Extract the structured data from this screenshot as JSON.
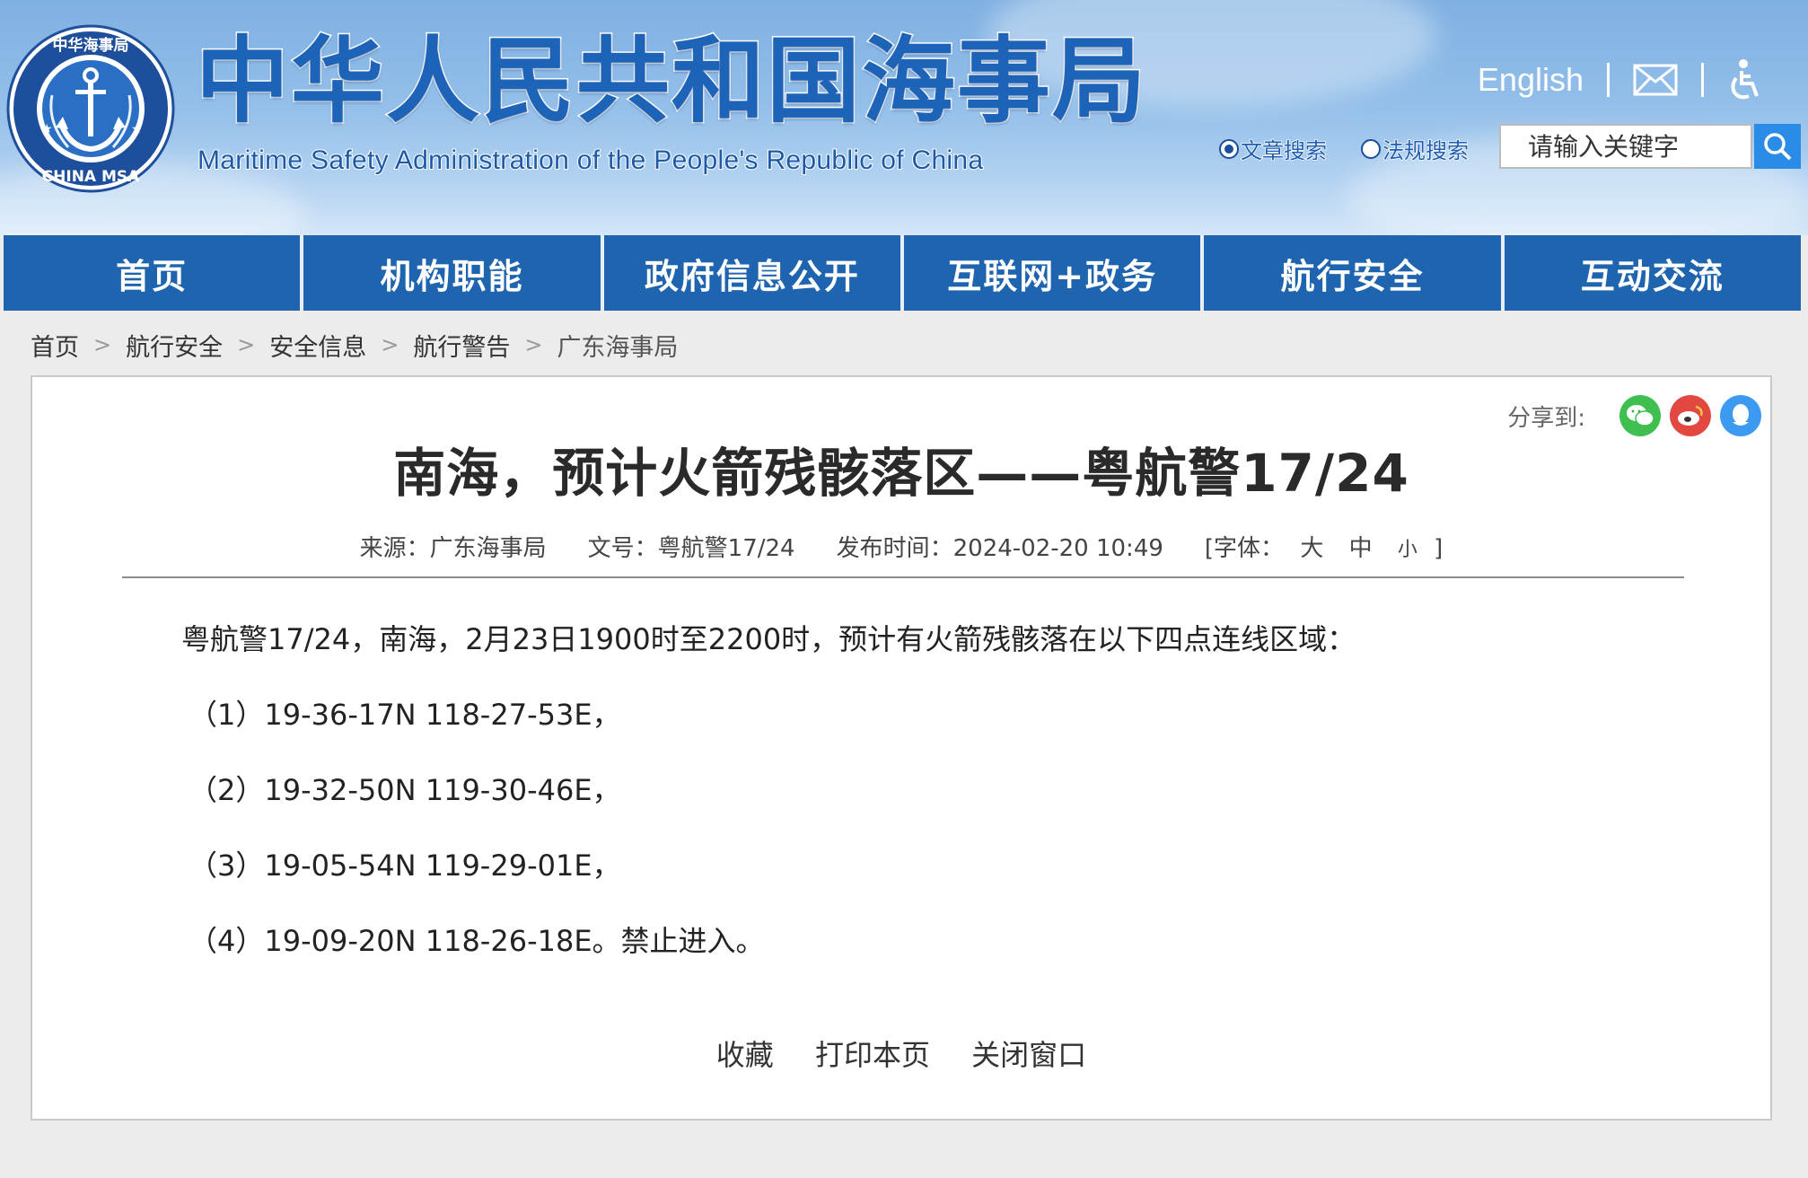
{
  "header": {
    "title": "中华人民共和国海事局",
    "subtitle": "Maritime Safety Administration of the People's Republic of China",
    "emblem_text_top": "中华海事局",
    "emblem_text_bottom": "CHINA MSA",
    "english_link": "English",
    "search_options": [
      "文章搜索",
      "法规搜索"
    ],
    "search_selected": "文章搜索",
    "search_placeholder": "请输入关键字",
    "icons": [
      "mail-icon",
      "accessibility-icon",
      "search-icon"
    ]
  },
  "nav": {
    "items": [
      "首页",
      "机构职能",
      "政府信息公开",
      "互联网+政务",
      "航行安全",
      "互动交流"
    ]
  },
  "breadcrumb": {
    "items": [
      "首页",
      "航行安全",
      "安全信息",
      "航行警告",
      "广东海事局"
    ],
    "separator": ">"
  },
  "article": {
    "share_label": "分享到:",
    "share_icons": [
      "wechat-icon",
      "weibo-icon",
      "qq-icon"
    ],
    "title": "南海，预计火箭残骸落区——粤航警17/24",
    "meta": {
      "source": "来源：广东海事局",
      "doc_no": "文号：粤航警17/24",
      "published": "发布时间：2024-02-20 10:49",
      "font_label": "[字体：",
      "font_sizes": [
        "大",
        "中",
        "小"
      ],
      "font_close": "]"
    },
    "lead": "粤航警17/24，南海，2月23日1900时至2200时，预计有火箭残骸落在以下四点连线区域：",
    "coords": [
      "（1）19-36-17N 118-27-53E，",
      "（2）19-32-50N 119-30-46E，",
      "（3）19-05-54N 119-29-01E，",
      "（4）19-09-20N 118-26-18E。禁止进入。"
    ],
    "actions": [
      "收藏",
      "打印本页",
      "关闭窗口"
    ]
  },
  "colors": {
    "nav_bg": "#1e64ae",
    "title_blue": "#1d63b8",
    "search_button": "#2a8ce6",
    "wechat": "#3fbf4f",
    "weibo": "#e2483f",
    "qq": "#3c9af0"
  }
}
